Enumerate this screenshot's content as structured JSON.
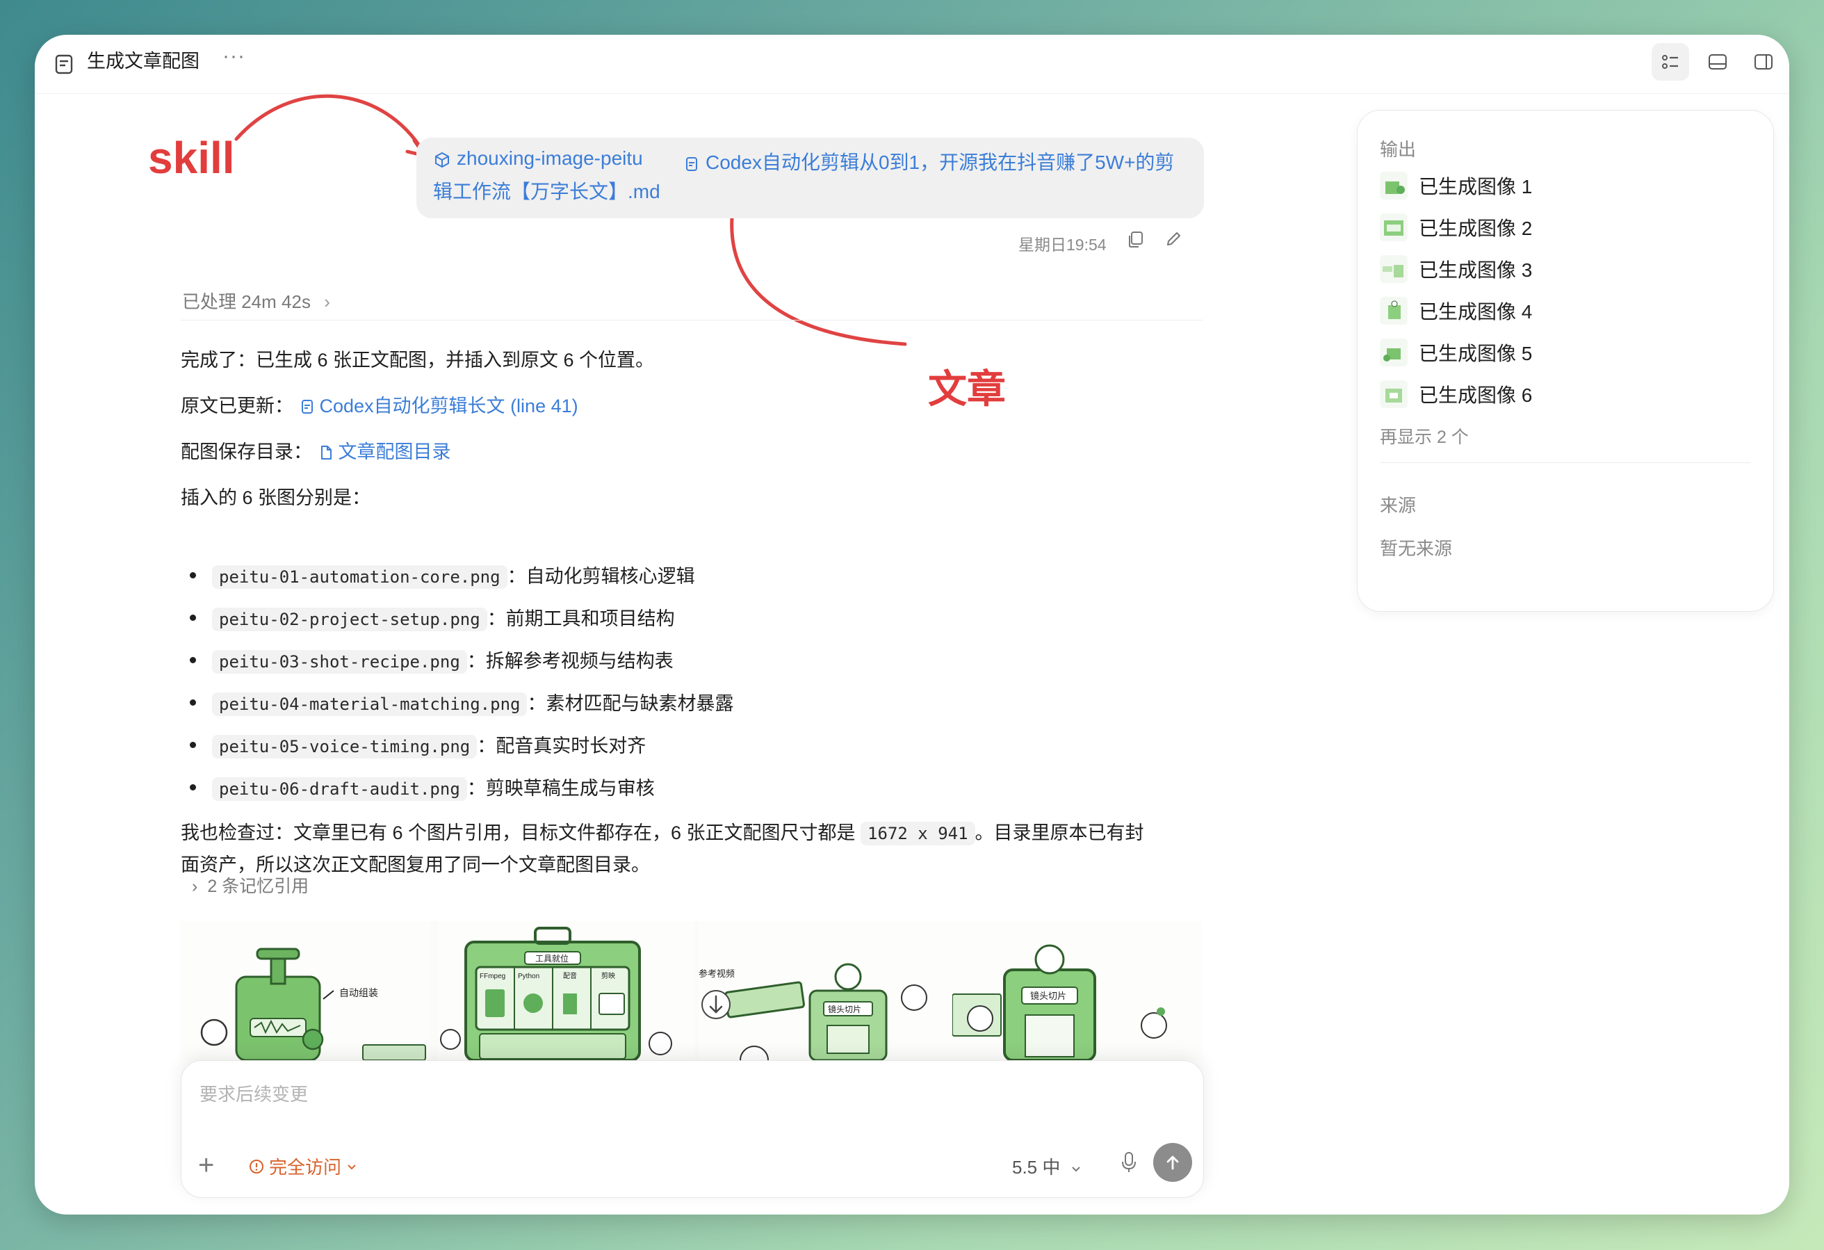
{
  "window": {
    "title": "生成文章配图",
    "more_label": "···"
  },
  "annotations": {
    "skill": "skill",
    "article": "文章"
  },
  "user_message": {
    "skill_chip": "zhouxing-image-peitu",
    "file_chip_line1": "Codex自动化剪辑从0到1，开源我在抖音赚了5W+的剪",
    "file_chip_line2": "辑工作流【万字长文】.md",
    "timestamp": "星期日19:54"
  },
  "assistant": {
    "processed": "已处理 24m 42s",
    "done_text": "完成了：已生成 6 张正文配图，并插入到原文 6 个位置。",
    "updated_label": "原文已更新：",
    "updated_link": "Codex自动化剪辑长文 (line 41)",
    "dir_label": "配图保存目录：",
    "dir_link": "文章配图目录",
    "list_intro": "插入的 6 张图分别是：",
    "items": [
      {
        "file": "peitu-01-automation-core.png",
        "desc": "：自动化剪辑核心逻辑"
      },
      {
        "file": "peitu-02-project-setup.png",
        "desc": "：前期工具和项目结构"
      },
      {
        "file": "peitu-03-shot-recipe.png",
        "desc": "：拆解参考视频与结构表"
      },
      {
        "file": "peitu-04-material-matching.png",
        "desc": "：素材匹配与缺素材暴露"
      },
      {
        "file": "peitu-05-voice-timing.png",
        "desc": "：配音真实时长对齐"
      },
      {
        "file": "peitu-06-draft-audit.png",
        "desc": "：剪映草稿生成与审核"
      }
    ],
    "check_pre": "我也检查过：文章里已有 6 个图片引用，目标文件都存在，6 张正文配图尺寸都是 ",
    "check_code": "1672 x 941",
    "check_post": "。目录里原本已有封",
    "check_line2": "面资产，所以这次正文配图复用了同一个文章配图目录。",
    "memory": "2 条记忆引用"
  },
  "image_labels": {
    "img1": "自动组装",
    "img2_title": "工具就位",
    "img2_t1": "FFmpeg",
    "img2_t2": "Python",
    "img2_t3": "配音",
    "img2_t4": "剪映",
    "img3_a": "参考视频",
    "img3_b": "镜头切片",
    "img4": "镜头切片"
  },
  "composer": {
    "placeholder": "要求后续变更",
    "access": "完全访问",
    "model": "5.5 中"
  },
  "side_panel": {
    "output_heading": "输出",
    "outputs": [
      "已生成图像 1",
      "已生成图像 2",
      "已生成图像 3",
      "已生成图像 4",
      "已生成图像 5",
      "已生成图像 6"
    ],
    "show_more": "再显示 2 个",
    "source_heading": "来源",
    "no_source": "暂无来源"
  },
  "colors": {
    "link": "#3b7dd8",
    "annotation_red": "#e23d3d",
    "access_orange": "#d9622b",
    "illustration_green": "#5fae5a"
  }
}
